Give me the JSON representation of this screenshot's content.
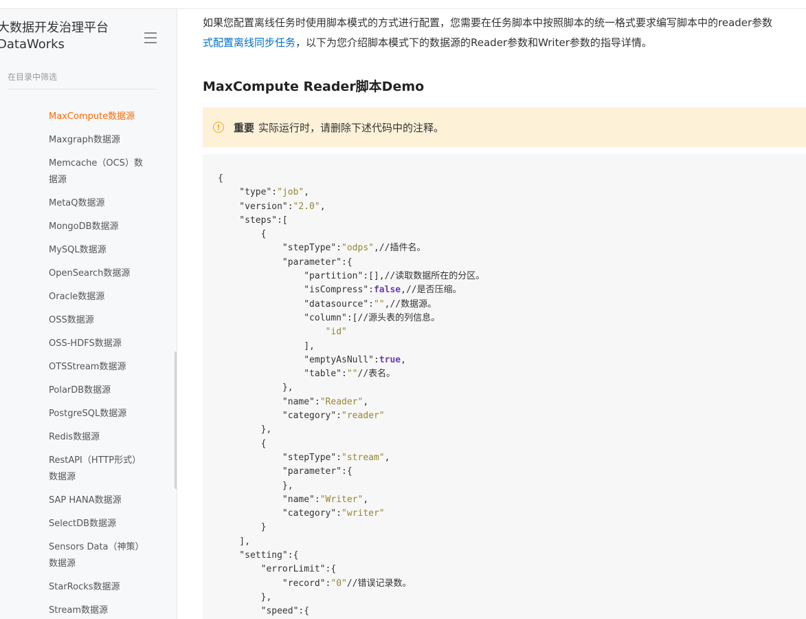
{
  "sidebar": {
    "product_title": "大数据开发治理平台 DataWorks",
    "filter_placeholder": "在目录中筛选",
    "items": [
      {
        "label": "MaxCompute数据源",
        "active": true
      },
      {
        "label": "Maxgraph数据源"
      },
      {
        "label": "Memcache（OCS）数据源"
      },
      {
        "label": "MetaQ数据源"
      },
      {
        "label": "MongoDB数据源"
      },
      {
        "label": "MySQL数据源"
      },
      {
        "label": "OpenSearch数据源"
      },
      {
        "label": "Oracle数据源"
      },
      {
        "label": "OSS数据源"
      },
      {
        "label": "OSS-HDFS数据源"
      },
      {
        "label": "OTSStream数据源"
      },
      {
        "label": "PolarDB数据源"
      },
      {
        "label": "PostgreSQL数据源"
      },
      {
        "label": "Redis数据源"
      },
      {
        "label": "RestAPI（HTTP形式）数据源"
      },
      {
        "label": "SAP HANA数据源"
      },
      {
        "label": "SelectDB数据源"
      },
      {
        "label": "Sensors Data（神策）数据源"
      },
      {
        "label": "StarRocks数据源"
      },
      {
        "label": "Stream数据源"
      }
    ]
  },
  "content": {
    "intro_part1": "如果您配置离线任务时使用脚本模式的方式进行配置，您需要在任务脚本中按照脚本的统一格式要求编写脚本中的reader参数",
    "intro_link": "式配置离线同步任务",
    "intro_part2": "，以下为您介绍脚本模式下的数据源的Reader参数和Writer参数的指导详情。",
    "heading": "MaxCompute Reader脚本Demo",
    "notice_label": "重要",
    "notice_text": "实际运行时，请删除下述代码中的注释。",
    "code_lines": [
      "{",
      "    \"type\":\"job\",",
      "    \"version\":\"2.0\",",
      "    \"steps\":[",
      "        {",
      "            \"stepType\":\"odps\",//插件名。",
      "            \"parameter\":{",
      "                \"partition\":[],//读取数据所在的分区。",
      "                \"isCompress\":false,//是否压缩。",
      "                \"datasource\":\"\",//数据源。",
      "                \"column\":[//源头表的列信息。",
      "                    \"id\"",
      "                ],",
      "                \"emptyAsNull\":true,",
      "                \"table\":\"\"//表名。",
      "            },",
      "            \"name\":\"Reader\",",
      "            \"category\":\"reader\"",
      "        },",
      "        {",
      "            \"stepType\":\"stream\",",
      "            \"parameter\":{",
      "            },",
      "            \"name\":\"Writer\",",
      "            \"category\":\"writer\"",
      "        }",
      "    ],",
      "    \"setting\":{",
      "        \"errorLimit\":{",
      "            \"record\":\"0\"//错误记录数。",
      "        },",
      "        \"speed\":{"
    ]
  }
}
